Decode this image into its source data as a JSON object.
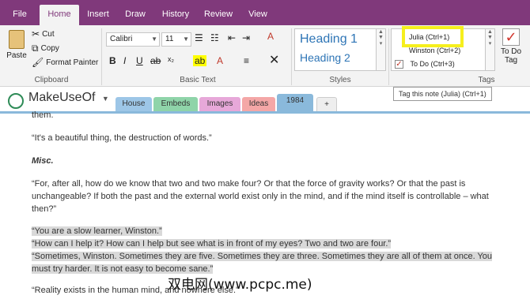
{
  "ribbon_tabs": [
    "File",
    "Home",
    "Insert",
    "Draw",
    "History",
    "Review",
    "View"
  ],
  "clipboard": {
    "paste": "Paste",
    "cut": "Cut",
    "copy": "Copy",
    "format_painter": "Format Painter",
    "label": "Clipboard"
  },
  "basic_text": {
    "font": "Calibri",
    "size": "11",
    "label": "Basic Text"
  },
  "styles": {
    "heading1": "Heading 1",
    "heading2": "Heading 2",
    "label": "Styles"
  },
  "tags": {
    "items": [
      "Julia (Ctrl+1)",
      "Winston (Ctrl+2)",
      "To Do (Ctrl+3)"
    ],
    "label": "Tags",
    "todo_tag": "To Do Tag"
  },
  "tooltip": "Tag this note (Julia) (Ctrl+1)",
  "notebook": {
    "name": "MakeUseOf",
    "sections": [
      "House",
      "Embeds",
      "Images",
      "Ideas",
      "1984",
      "+"
    ]
  },
  "page": {
    "line0": "them.",
    "quote1": "“It's a beautiful thing, the destruction of words.”",
    "heading_misc": "Misc.",
    "para1_l1": "“For, after all, how do we know that two and two make four? Or that the force of gravity works? Or that the past is",
    "para1_l2": "unchangeable? If both the past and the external world exist only in the mind, and if the mind itself is controllable – what",
    "para1_l3": "then?”",
    "hl1": "“You are a slow learner, Winston.”",
    "hl2": "“How can I help it? How can I help but see what is in front of my eyes? Two and two are four.”",
    "hl3": "“Sometimes, Winston. Sometimes they are five. Sometimes they are three. Sometimes they are all of them at once. You",
    "hl4": "must try harder. It is not easy to become sane.”",
    "last": "“Reality exists in the human mind, and nowhere else.”"
  },
  "watermark": "双电网(www.pcpc.me)"
}
